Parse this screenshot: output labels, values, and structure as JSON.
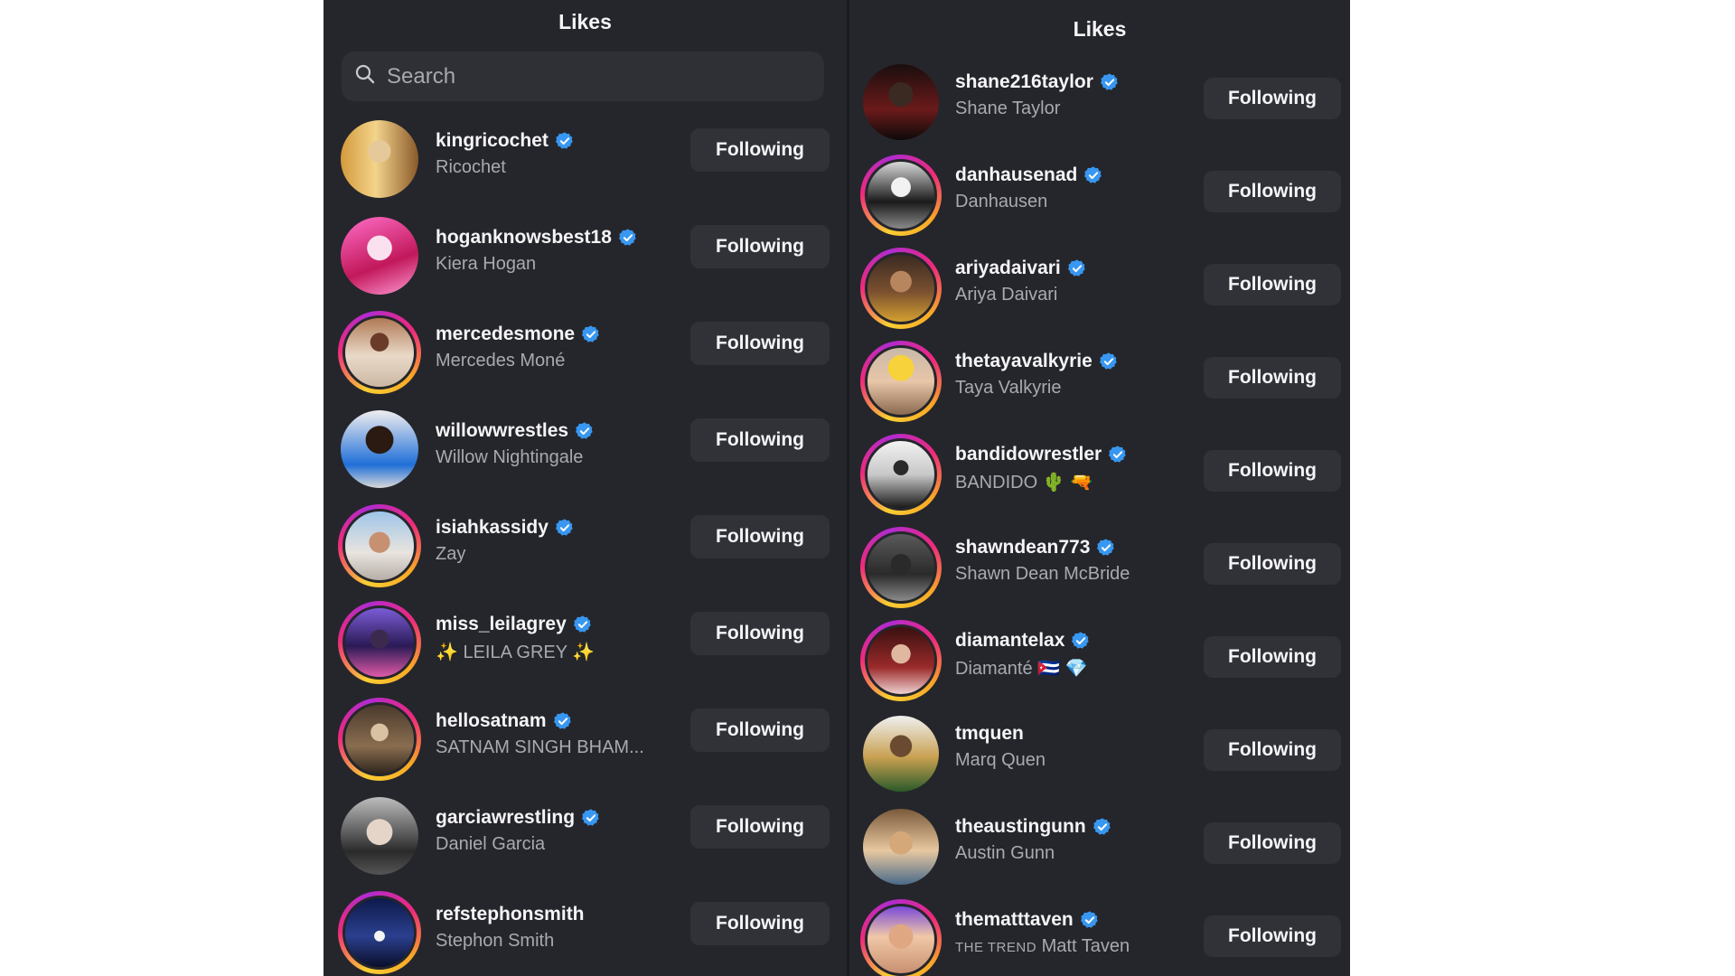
{
  "left_panel": {
    "title": "Likes",
    "search_placeholder": "Search",
    "items": [
      {
        "username": "kingricochet",
        "name": "Ricochet",
        "verified": true,
        "ring": false,
        "button": "Following"
      },
      {
        "username": "hoganknowsbest18",
        "name": "Kiera Hogan",
        "verified": true,
        "ring": false,
        "button": "Following"
      },
      {
        "username": "mercedesmone",
        "name": "Mercedes Moné",
        "verified": true,
        "ring": true,
        "button": "Following"
      },
      {
        "username": "willowwrestles",
        "name": "Willow Nightingale",
        "verified": true,
        "ring": false,
        "button": "Following"
      },
      {
        "username": "isiahkassidy",
        "name": "Zay",
        "verified": true,
        "ring": true,
        "button": "Following"
      },
      {
        "username": "miss_leilagrey",
        "name": "✨ LEILA GREY ✨",
        "verified": true,
        "ring": true,
        "button": "Following"
      },
      {
        "username": "hellosatnam",
        "name": "SATNAM SINGH BHAM...",
        "verified": true,
        "ring": true,
        "button": "Following"
      },
      {
        "username": "garciawrestling",
        "name": "Daniel Garcia",
        "verified": true,
        "ring": false,
        "button": "Following"
      },
      {
        "username": "refstephonsmith",
        "name": "Stephon Smith",
        "verified": false,
        "ring": true,
        "button": "Following"
      }
    ]
  },
  "right_panel": {
    "title": "Likes",
    "items": [
      {
        "username": "shane216taylor",
        "name": "Shane Taylor",
        "verified": true,
        "ring": false,
        "button": "Following"
      },
      {
        "username": "danhausenad",
        "name": "Danhausen",
        "verified": true,
        "ring": true,
        "button": "Following"
      },
      {
        "username": "ariyadaivari",
        "name": "Ariya Daivari",
        "verified": true,
        "ring": true,
        "button": "Following"
      },
      {
        "username": "thetayavalkyrie",
        "name": "Taya Valkyrie",
        "verified": true,
        "ring": true,
        "button": "Following"
      },
      {
        "username": "bandidowrestler",
        "name": "BANDIDO 🌵 🔫",
        "verified": true,
        "ring": true,
        "button": "Following"
      },
      {
        "username": "shawndean773",
        "name": "Shawn Dean McBride",
        "verified": true,
        "ring": true,
        "button": "Following"
      },
      {
        "username": "diamantelax",
        "name": "Diamanté 🇨🇺 💎",
        "verified": true,
        "ring": true,
        "button": "Following"
      },
      {
        "username": "tmquen",
        "name": "Marq Quen",
        "verified": false,
        "ring": false,
        "button": "Following"
      },
      {
        "username": "theaustingunn",
        "name": "Austin Gunn",
        "verified": true,
        "ring": false,
        "button": "Following"
      },
      {
        "username": "thematttaven",
        "name_prefix": "THE TREND",
        "name": "Matt Taven",
        "verified": true,
        "ring": true,
        "button": "Following"
      }
    ]
  },
  "colors": {
    "panel_bg": "#25262b",
    "button_bg": "#303238",
    "verified_blue": "#3897f0",
    "secondary_text": "#a8aab1"
  },
  "icons": {
    "search": "search-icon",
    "verified": "verified-badge-icon"
  }
}
